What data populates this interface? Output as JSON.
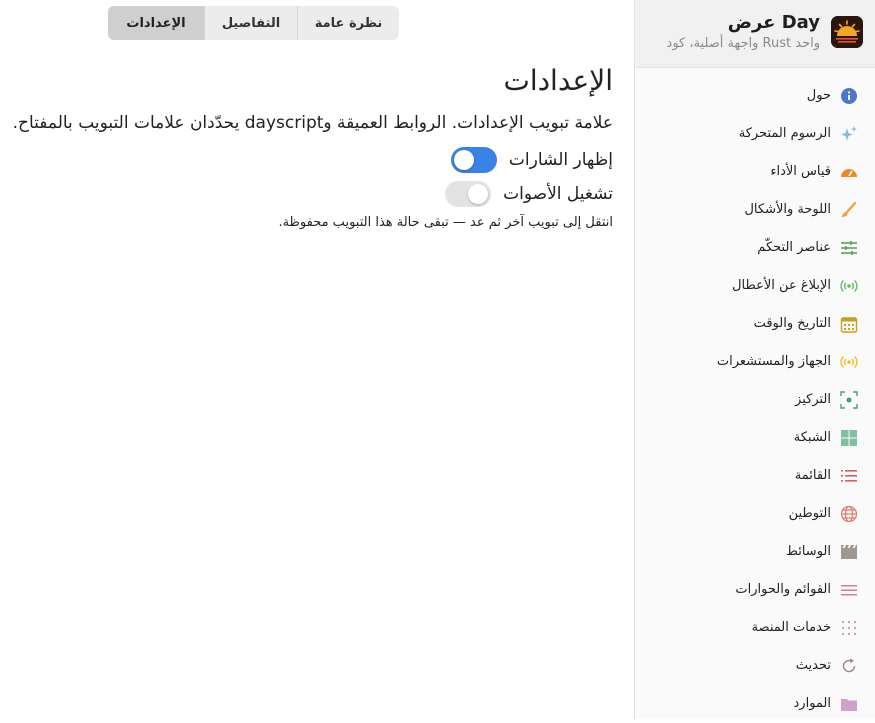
{
  "app": {
    "title": "عرض Day",
    "subtitle": "واجهة أصلية، كود Rust واحد",
    "logo_icon": "sunset-logo-icon"
  },
  "colors": {
    "accent": "#3b82e6",
    "sidebar_bg": "#fafafa",
    "header_bg": "#f1f1f1",
    "active_tab_bg": "#cfcfcf"
  },
  "sidebar": {
    "items": [
      {
        "label": "حول",
        "icon": "info-icon",
        "color": "#4a78c8"
      },
      {
        "label": "الرسوم المتحركة",
        "icon": "sparkles-icon",
        "color": "#8ab8e8"
      },
      {
        "label": "قياس الأداء",
        "icon": "gauge-icon",
        "color": "#f08a1c"
      },
      {
        "label": "اللوحة والأشكال",
        "icon": "paintbrush-icon",
        "color": "#f0a040"
      },
      {
        "label": "عناصر التحكّم",
        "icon": "sliders-icon",
        "color": "#5aa05a"
      },
      {
        "label": "الإبلاغ عن الأعطال",
        "icon": "broadcast-icon",
        "color": "#60c060"
      },
      {
        "label": "التاريخ والوقت",
        "icon": "calendar-icon",
        "color": "#c8a020"
      },
      {
        "label": "الجهاز والمستشعرات",
        "icon": "sensor-icon",
        "color": "#f0c020"
      },
      {
        "label": "التركيز",
        "icon": "focus-icon",
        "color": "#40a080"
      },
      {
        "label": "الشبكة",
        "icon": "grid-icon",
        "color": "#80c0a0"
      },
      {
        "label": "القائمة",
        "icon": "list-icon",
        "color": "#d06060"
      },
      {
        "label": "التوطين",
        "icon": "globe-icon",
        "color": "#e08070"
      },
      {
        "label": "الوسائط",
        "icon": "film-icon",
        "color": "#a09890"
      },
      {
        "label": "القوائم والحوارات",
        "icon": "menu-icon",
        "color": "#d08090"
      },
      {
        "label": "خدمات المنصة",
        "icon": "dots-grid-icon",
        "color": "#d0a0b0"
      },
      {
        "label": "تحديث",
        "icon": "refresh-icon",
        "color": "#b080a0"
      },
      {
        "label": "الموارد",
        "icon": "folder-icon",
        "color": "#d0a0c8"
      }
    ]
  },
  "tabs": [
    {
      "label": "نظرة عامة",
      "active": false
    },
    {
      "label": "التفاصيل",
      "active": false
    },
    {
      "label": "الإعدادات",
      "active": true
    }
  ],
  "main": {
    "title": "الإعدادات",
    "description": "علامة تبويب الإعدادات. الروابط العميقة وdayscript يحدّدان علامات التبويب بالمفتاح.",
    "toggles": [
      {
        "label": "إظهار الشارات",
        "on": true
      },
      {
        "label": "تشغيل الأصوات",
        "on": false
      }
    ],
    "hint": "انتقل إلى تبويب آخر ثم عد — تبقى حالة هذا التبويب محفوظة."
  }
}
